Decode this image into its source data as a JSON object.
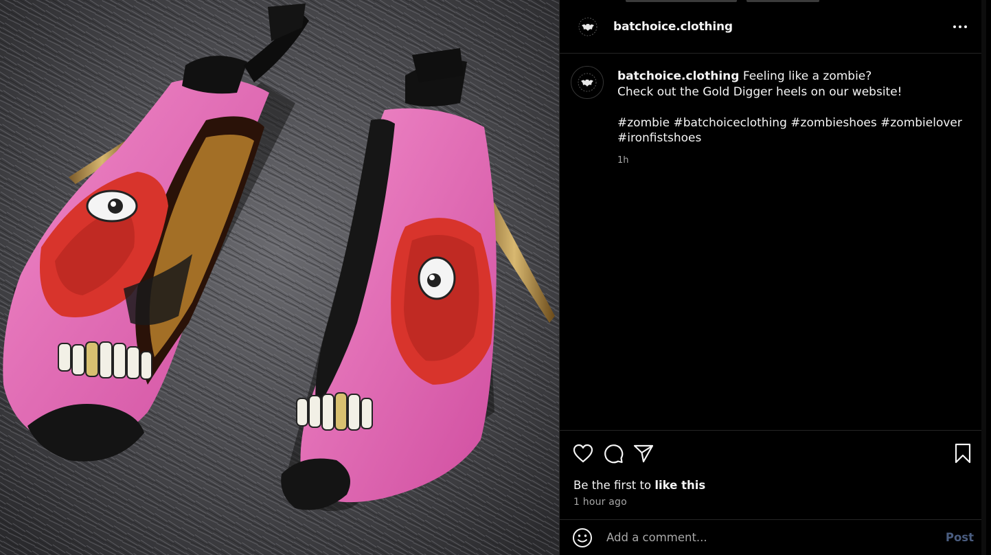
{
  "post": {
    "username": "batchoice.clothing",
    "caption_lines": [
      "Feeling like a zombie?",
      "Check out the Gold Digger heels on our website!",
      "",
      "#zombie #batchoiceclothing #zombieshoes #zombielover",
      "#ironfistshoes"
    ],
    "caption_time": "1h",
    "likes_prefix": "Be the first to ",
    "likes_action": "like this",
    "posted_ago": "1 hour ago",
    "comment_placeholder": "Add a comment...",
    "post_label": "Post"
  },
  "icons": {
    "more": "more-options-icon",
    "like": "heart-icon",
    "comment": "comment-bubble-icon",
    "share": "paper-plane-icon",
    "save": "bookmark-icon",
    "emoji": "smiley-icon",
    "avatar": "bat-logo-icon"
  },
  "colors": {
    "background": "#000000",
    "text": "#f5f5f5",
    "secondary_text": "#a8a8a8",
    "divider": "#262626",
    "post_button_disabled": "#4a5d80",
    "shoe_pink": "#e86ab8",
    "shoe_red": "#d8342c",
    "fur": "#4a4a4e"
  }
}
